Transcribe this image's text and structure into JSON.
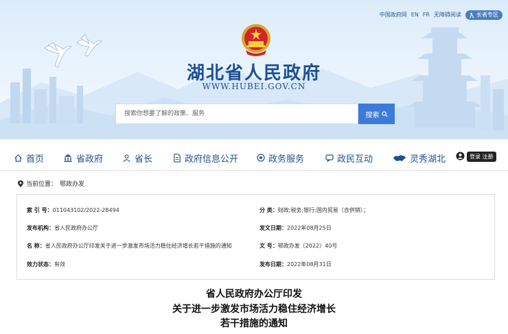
{
  "toplinks": {
    "gov_link": "中国政府网",
    "en": "EN",
    "fr": "FR",
    "accessible": "无障碍阅读",
    "elder": "长者专区"
  },
  "site": {
    "title": "湖北省人民政府",
    "url": "WWW.HUBEI.GOV.CN"
  },
  "search": {
    "placeholder": "搜索你想要了解的政策、服务",
    "button": "搜索"
  },
  "nav": {
    "home": "首页",
    "gov": "省政府",
    "governor": "省长",
    "info": "政府信息公开",
    "service": "政务服务",
    "interact": "政民互动",
    "lingxiu": "灵秀湖北",
    "login": "登录 注册"
  },
  "breadcrumb": {
    "label": "当前位置：",
    "current": "鄂政办发"
  },
  "info": {
    "index_label": "索 引 号：",
    "index_value": "011043102/2022-28494",
    "category_label": "分 类：",
    "category_value": "财政;税务;银行;国内贸易（含供销）；",
    "publisher_label": "发布机构：",
    "publisher_value": "省人民政府办公厅",
    "issue_date_label": "发文日期：",
    "issue_date_value": "2022年08月25日",
    "name_label": "名 称：",
    "name_value": "省人民政府办公厅印发关于进一步激发市场活力稳住经济增长若干措施的通知",
    "docno_label": "文 号：",
    "docno_value": "鄂政办发〔2022〕40号",
    "status_label": "效力状态：",
    "status_value": "有效",
    "pub_date_label": "发布日期：",
    "pub_date_value": "2022年08月31日"
  },
  "doc": {
    "line1": "省人民政府办公厅印发",
    "line2": "关于进一步激发市场活力稳住经济增长",
    "line3": "若干措施的通知"
  },
  "colors": {
    "brand": "#1c4f96",
    "search_button": "#3d7bd9",
    "nav_text": "#1f4f8f"
  }
}
